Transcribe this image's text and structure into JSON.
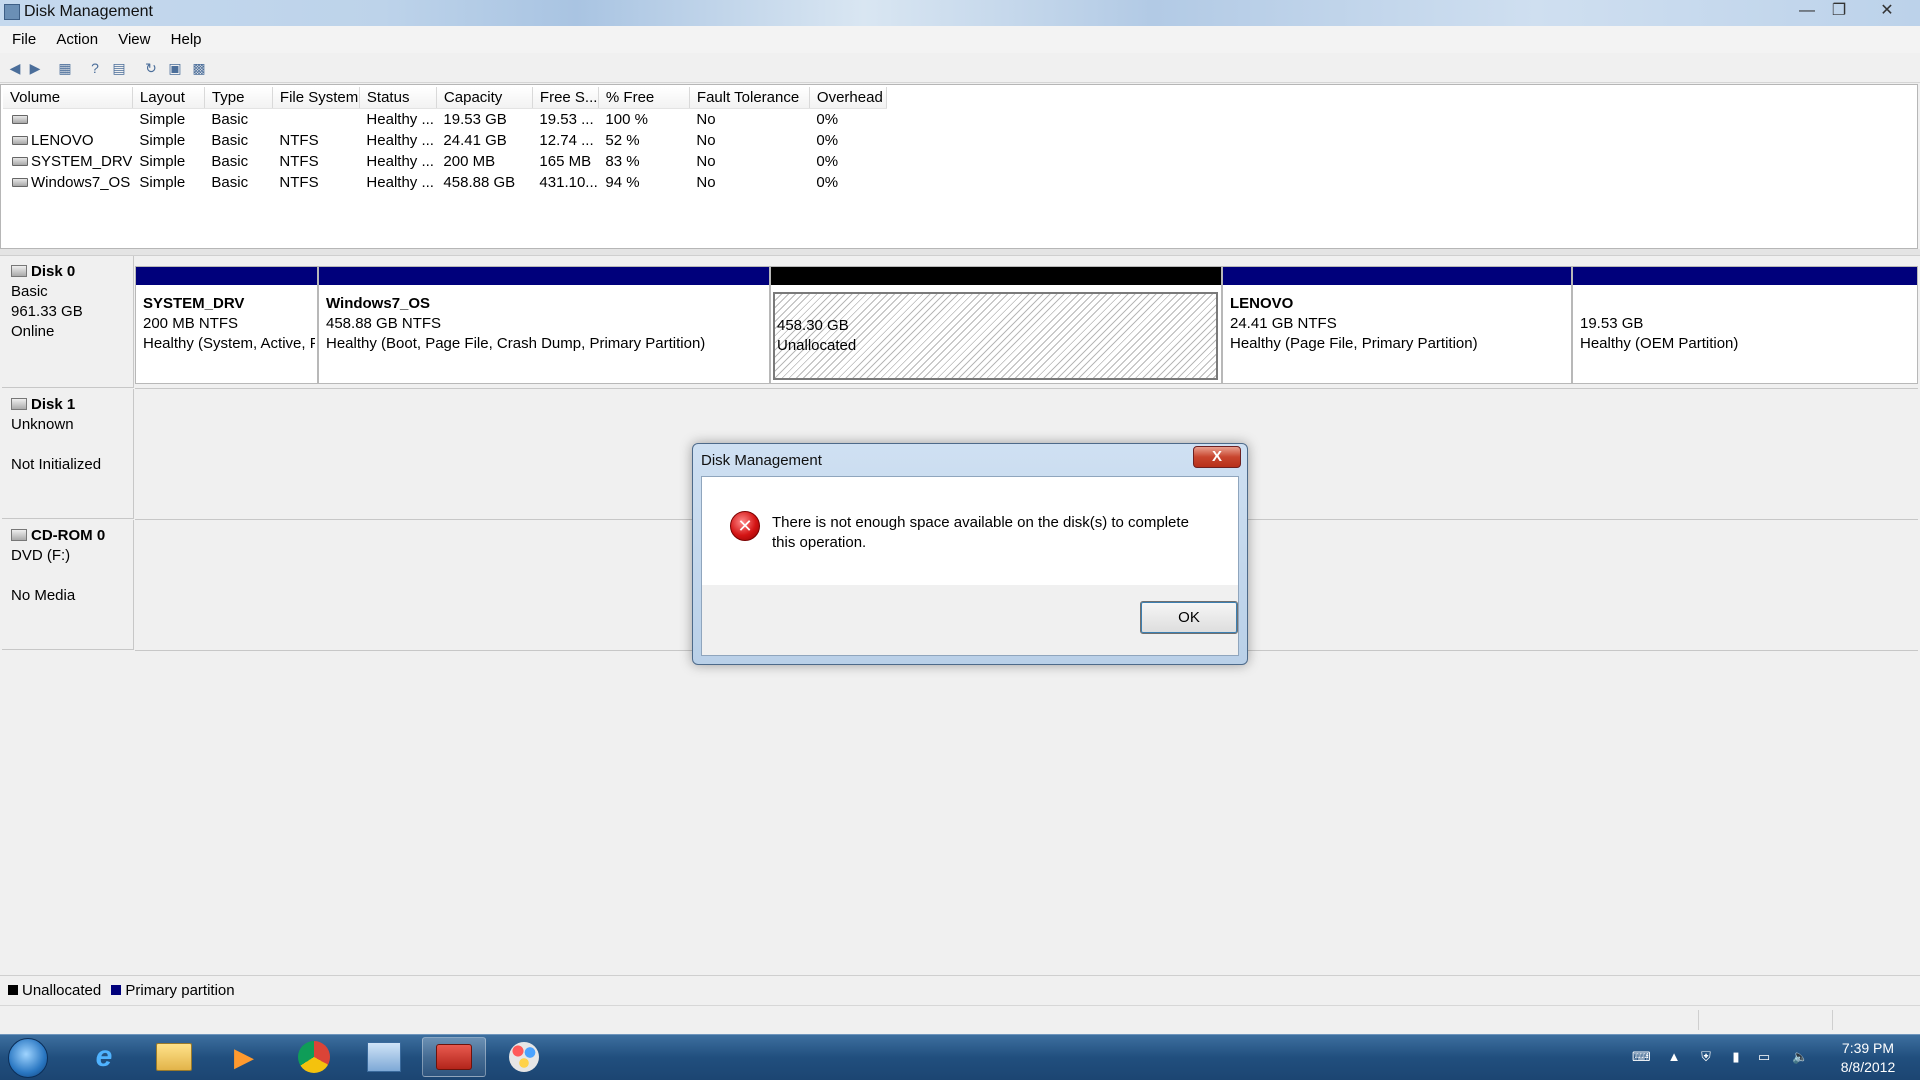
{
  "window": {
    "title": "Disk Management"
  },
  "menu": [
    "File",
    "Action",
    "View",
    "Help"
  ],
  "volume_table": {
    "columns": [
      "Volume",
      "Layout",
      "Type",
      "File System",
      "Status",
      "Capacity",
      "Free S...",
      "% Free",
      "Fault Tolerance",
      "Overhead"
    ],
    "rows": [
      [
        "",
        "Simple",
        "Basic",
        "",
        "Healthy ...",
        "19.53 GB",
        "19.53 ...",
        "100 %",
        "No",
        "0%"
      ],
      [
        "LENOVO",
        "Simple",
        "Basic",
        "NTFS",
        "Healthy ...",
        "24.41 GB",
        "12.74 ...",
        "52 %",
        "No",
        "0%"
      ],
      [
        "SYSTEM_DRV",
        "Simple",
        "Basic",
        "NTFS",
        "Healthy ...",
        "200 MB",
        "165 MB",
        "83 %",
        "No",
        "0%"
      ],
      [
        "Windows7_OS",
        "Simple",
        "Basic",
        "NTFS",
        "Healthy ...",
        "458.88 GB",
        "431.10...",
        "94 %",
        "No",
        "0%"
      ]
    ]
  },
  "disks": [
    {
      "name": "Disk 0",
      "line2": "Basic",
      "line3": "961.33 GB",
      "line4": "Online",
      "partitions": [
        {
          "name": "SYSTEM_DRV",
          "size": "200 MB NTFS",
          "status": "Healthy (System, Active, Primary Partition)"
        },
        {
          "name": "Windows7_OS",
          "size": "458.88 GB NTFS",
          "status": "Healthy (Boot, Page File, Crash Dump, Primary Partition)"
        },
        {
          "name": "",
          "size": "458.30 GB",
          "status": "Unallocated"
        },
        {
          "name": "LENOVO",
          "size": "24.41 GB NTFS",
          "status": "Healthy (Page File, Primary Partition)"
        },
        {
          "name": "",
          "size": "19.53 GB",
          "status": "Healthy (OEM Partition)"
        }
      ]
    },
    {
      "name": "Disk 1",
      "line2": "Unknown",
      "line3": "",
      "line4": "Not Initialized"
    },
    {
      "name": "CD-ROM 0",
      "line2": "DVD (F:)",
      "line3": "",
      "line4": "No Media"
    }
  ],
  "legend": [
    {
      "label": "Unallocated",
      "color": "#000000"
    },
    {
      "label": "Primary partition",
      "color": "#00007b"
    }
  ],
  "dialog": {
    "title": "Disk Management",
    "close": "X",
    "message": "There is not enough space available on the disk(s) to complete this operation.",
    "ok": "OK"
  },
  "taskbar": {
    "time": "7:39 PM",
    "date": "8/8/2012"
  },
  "colors": {
    "primary_partition": "#00007b",
    "unallocated": "#000000",
    "taskbar": "#214f7e"
  }
}
